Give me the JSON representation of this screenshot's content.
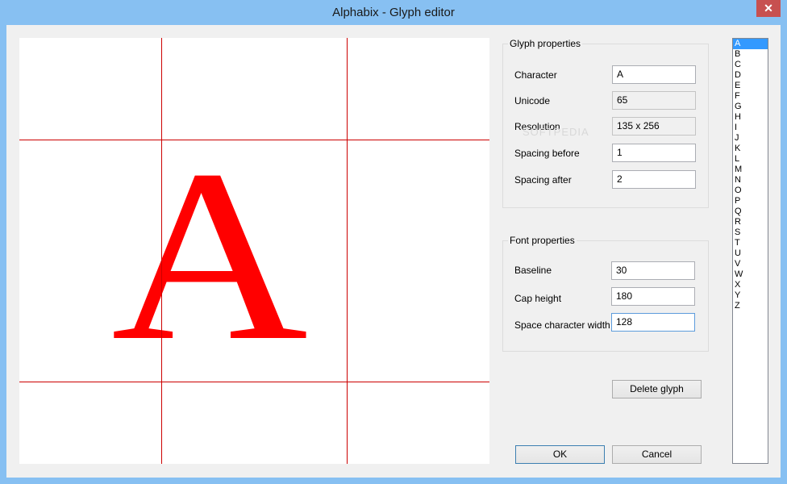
{
  "window": {
    "title": "Alphabix - Glyph editor",
    "close_symbol": "✕"
  },
  "canvas": {
    "glyph_char": "A",
    "glyph_color": "#ff0000",
    "guide_color": "#cc0000"
  },
  "glyph_properties": {
    "title": "Glyph properties",
    "character_label": "Character",
    "character_value": "A",
    "unicode_label": "Unicode",
    "unicode_value": "65",
    "resolution_label": "Resolution",
    "resolution_value": "135 x 256",
    "spacing_before_label": "Spacing before",
    "spacing_before_value": "1",
    "spacing_after_label": "Spacing after",
    "spacing_after_value": "2"
  },
  "font_properties": {
    "title": "Font properties",
    "baseline_label": "Baseline",
    "baseline_value": "30",
    "cap_height_label": "Cap height",
    "cap_height_value": "180",
    "space_width_label": "Space character width",
    "space_width_value": "128"
  },
  "buttons": {
    "delete_glyph": "Delete glyph",
    "ok": "OK",
    "cancel": "Cancel"
  },
  "glyph_list": {
    "selected_index": 0,
    "items": [
      "A",
      "B",
      "C",
      "D",
      "E",
      "F",
      "G",
      "H",
      "I",
      "J",
      "K",
      "L",
      "M",
      "N",
      "O",
      "P",
      "Q",
      "R",
      "S",
      "T",
      "U",
      "V",
      "W",
      "X",
      "Y",
      "Z"
    ]
  },
  "watermark": "SOFTPEDIA"
}
